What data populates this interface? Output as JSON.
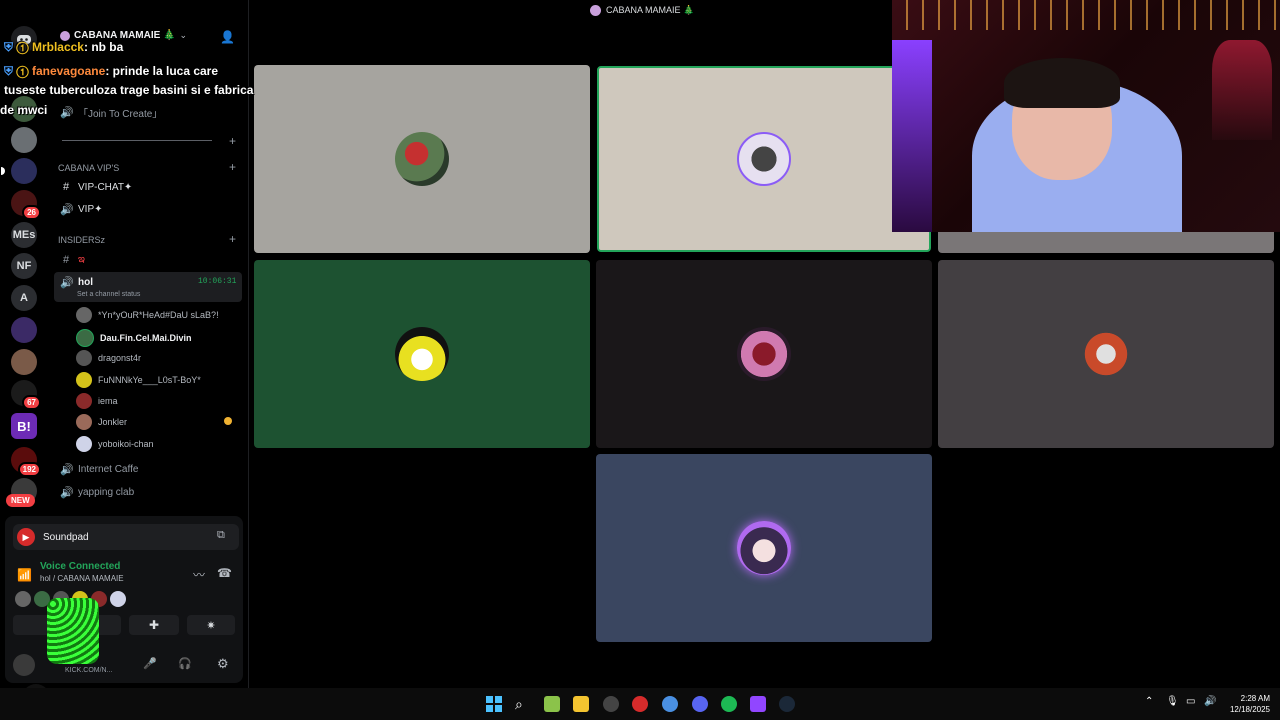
{
  "window": {
    "title": "CABANA MAMAIE 🎄"
  },
  "server": {
    "name": "CABANA MAMAIE 🎄"
  },
  "rail": {
    "items": [
      {
        "label": "",
        "badge": ""
      },
      {
        "label": "",
        "badge": ""
      },
      {
        "label": "",
        "badge": ""
      },
      {
        "label": "",
        "badge": "26"
      },
      {
        "label": "MEs",
        "badge": ""
      },
      {
        "label": "NF",
        "badge": ""
      },
      {
        "label": "A",
        "badge": ""
      },
      {
        "label": "",
        "badge": ""
      },
      {
        "label": "",
        "badge": ""
      },
      {
        "label": "",
        "badge": "67"
      },
      {
        "label": "B!",
        "badge": ""
      },
      {
        "label": "",
        "badge": "192"
      },
      {
        "label": "NEW",
        "badge": ""
      }
    ]
  },
  "sidebar": {
    "join_to_create": "「Join To Create」",
    "category_vip": "CABANA VIP'S",
    "vip_chat": "VIP-CHAT✦",
    "vip_voice": "VIP✦",
    "category_insiders": "INSIDERSz",
    "insiders_text": "ఇ",
    "active_channel": {
      "name": "hol",
      "timer": "10:06:31",
      "status": "Set a channel status"
    },
    "voice_users": [
      "*Yn*yOuR*HeAd#DaU sLaB?!",
      "Dau.Fin.Cel.Mai.Divin",
      "dragonst4r",
      "FuNNNkYe___L0sT-BoY*",
      "iema",
      "Jonkler",
      "yoboikoi-chan"
    ],
    "voice_channels": [
      "Internet Caffe",
      "yapping clab"
    ]
  },
  "panel": {
    "soundpad": "Soundpad",
    "voice_connected": "Voice Connected",
    "voice_location": "hol / CABANA MAMAIE",
    "user_status": "KICK.COM/N..."
  },
  "chat_overlay": [
    {
      "user": "Mrblacck",
      "text": ": nb ba"
    },
    {
      "user": "fanevagoane",
      "text": ": prinde la luca care"
    },
    {
      "user": "",
      "text": "tuseste tuberculoza trage basini si e fabrica"
    },
    {
      "user": "",
      "text": "de mwci"
    }
  ],
  "streamer_watermark": "navashy1",
  "taskbar": {
    "time": "2:28 AM",
    "date": "12/18/2025"
  },
  "colors": {
    "tile_gray": "#a6a49f",
    "tile_cream": "#cfc8bd",
    "tile_green": "#1d5231",
    "tile_dark": "#1a1719",
    "tile_slate": "#433f42",
    "tile_blue": "#3a4660",
    "accent_green": "#23a55a",
    "chat_user_yellow": "#f0c020",
    "chat_user_orange": "#ff8a3d"
  }
}
